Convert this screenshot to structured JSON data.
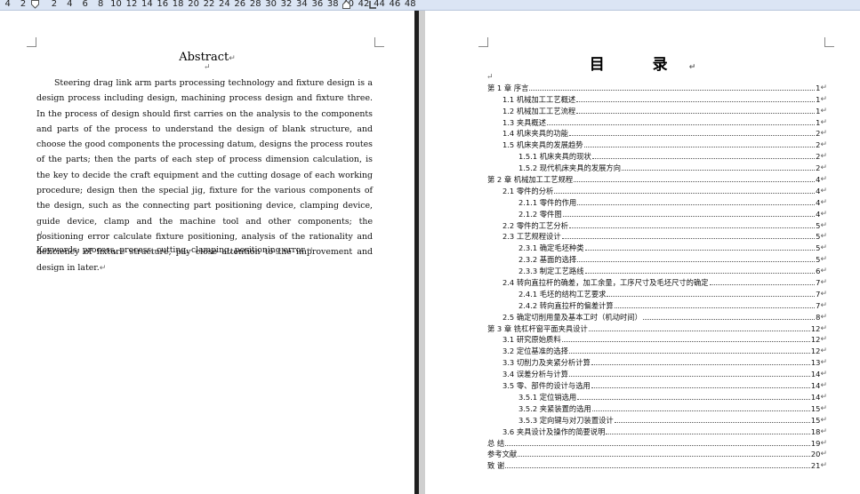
{
  "ruler": {
    "numbers": [
      "4",
      "2",
      "",
      "2",
      "4",
      "6",
      "8",
      "10",
      "12",
      "14",
      "16",
      "18",
      "20",
      "22",
      "24",
      "26",
      "28",
      "30",
      "32",
      "34",
      "36",
      "38",
      "40",
      "42",
      "44",
      "46",
      "48"
    ]
  },
  "left_page": {
    "abstract_title": "Abstract",
    "abstract_text": "Steering drag link arm parts processing technology and fixture design is a design process including design, machining process design and fixture three. In the process of design should first carries on the analysis to the components and parts of the process to understand the design of blank structure, and choose the good components the processing datum, designs the process routes of the parts; then the parts of each step of process dimension calculation, is the key to decide the craft equipment and the cutting dosage of each working procedure; design then the special jig, fixture for the various components of the design, such as the connecting part positioning device, clamping device, guide device, clamp and the machine tool and other components; the positioning error calculate fixture positioning, analysis of the rationality and deficiency of fixture structure, pay close attention to the improvement and design in later.",
    "keywords": "Keywords: process, process, cutting, clamping, positioning error."
  },
  "right_page": {
    "toc_title": "目 录",
    "toc": [
      {
        "label": "第 1 章  序言",
        "page": "1"
      },
      {
        "label": "1.1  机械加工工艺概述",
        "page": "1"
      },
      {
        "label": "1.2 机械加工工艺流程",
        "page": "1"
      },
      {
        "label": "1.3 夹具概述",
        "page": "1"
      },
      {
        "label": "1.4 机床夹具的功能",
        "page": "2"
      },
      {
        "label": "1.5 机床夹具的发展趋势",
        "page": "2"
      },
      {
        "label": "1.5.1 机床夹具的现状",
        "page": "2"
      },
      {
        "label": "1.5.2 现代机床夹具的发展方向",
        "page": "2"
      },
      {
        "label": "第 2 章  机械加工工艺规程",
        "page": "4"
      },
      {
        "label": "2.1 零件的分析",
        "page": "4"
      },
      {
        "label": "2.1.1 零件的作用",
        "page": "4"
      },
      {
        "label": "2.1.2 零件图",
        "page": "4"
      },
      {
        "label": "2.2  零件的工艺分析",
        "page": "5"
      },
      {
        "label": "2.3 工艺规程设计",
        "page": "5"
      },
      {
        "label": "2.3.1 确定毛坯种类",
        "page": "5"
      },
      {
        "label": "2.3.2 基面的选择",
        "page": "5"
      },
      {
        "label": "2.3.3 制定工艺路线",
        "page": "6"
      },
      {
        "label": "2.4 转向直拉杆的确差，加工余量，工序尺寸及毛坯尺寸的确定",
        "page": "7"
      },
      {
        "label": "2.4.1 毛坯的结构工艺要求",
        "page": "7"
      },
      {
        "label": "2.4.2 转向直拉杆的偏差计算",
        "page": "7"
      },
      {
        "label": "2.5 确定切削用量及基本工时（机动时间）",
        "page": "8"
      },
      {
        "label": "第 3 章  铣杠杆窗平面夹具设计",
        "page": "12"
      },
      {
        "label": "3.1 研究原始质料",
        "page": "12"
      },
      {
        "label": "3.2 定位基准的选择",
        "page": "12"
      },
      {
        "label": "3.3  切削力及夹紧分析计算",
        "page": "13"
      },
      {
        "label": "3.4  误差分析与计算",
        "page": "14"
      },
      {
        "label": "3.5  零、部件的设计与选用",
        "page": "14"
      },
      {
        "label": "3.5.1 定位销选用",
        "page": "14"
      },
      {
        "label": "3.5.2 夹紧装置的选用",
        "page": "15"
      },
      {
        "label": "3.5.3  定向键与对刀装置设计",
        "page": "15"
      },
      {
        "label": "3.6  夹具设计及操作的简要说明",
        "page": "18"
      },
      {
        "label": "总    结",
        "page": "19"
      },
      {
        "label": "参考文献",
        "page": "20"
      },
      {
        "label": "致    谢",
        "page": "21"
      }
    ]
  }
}
